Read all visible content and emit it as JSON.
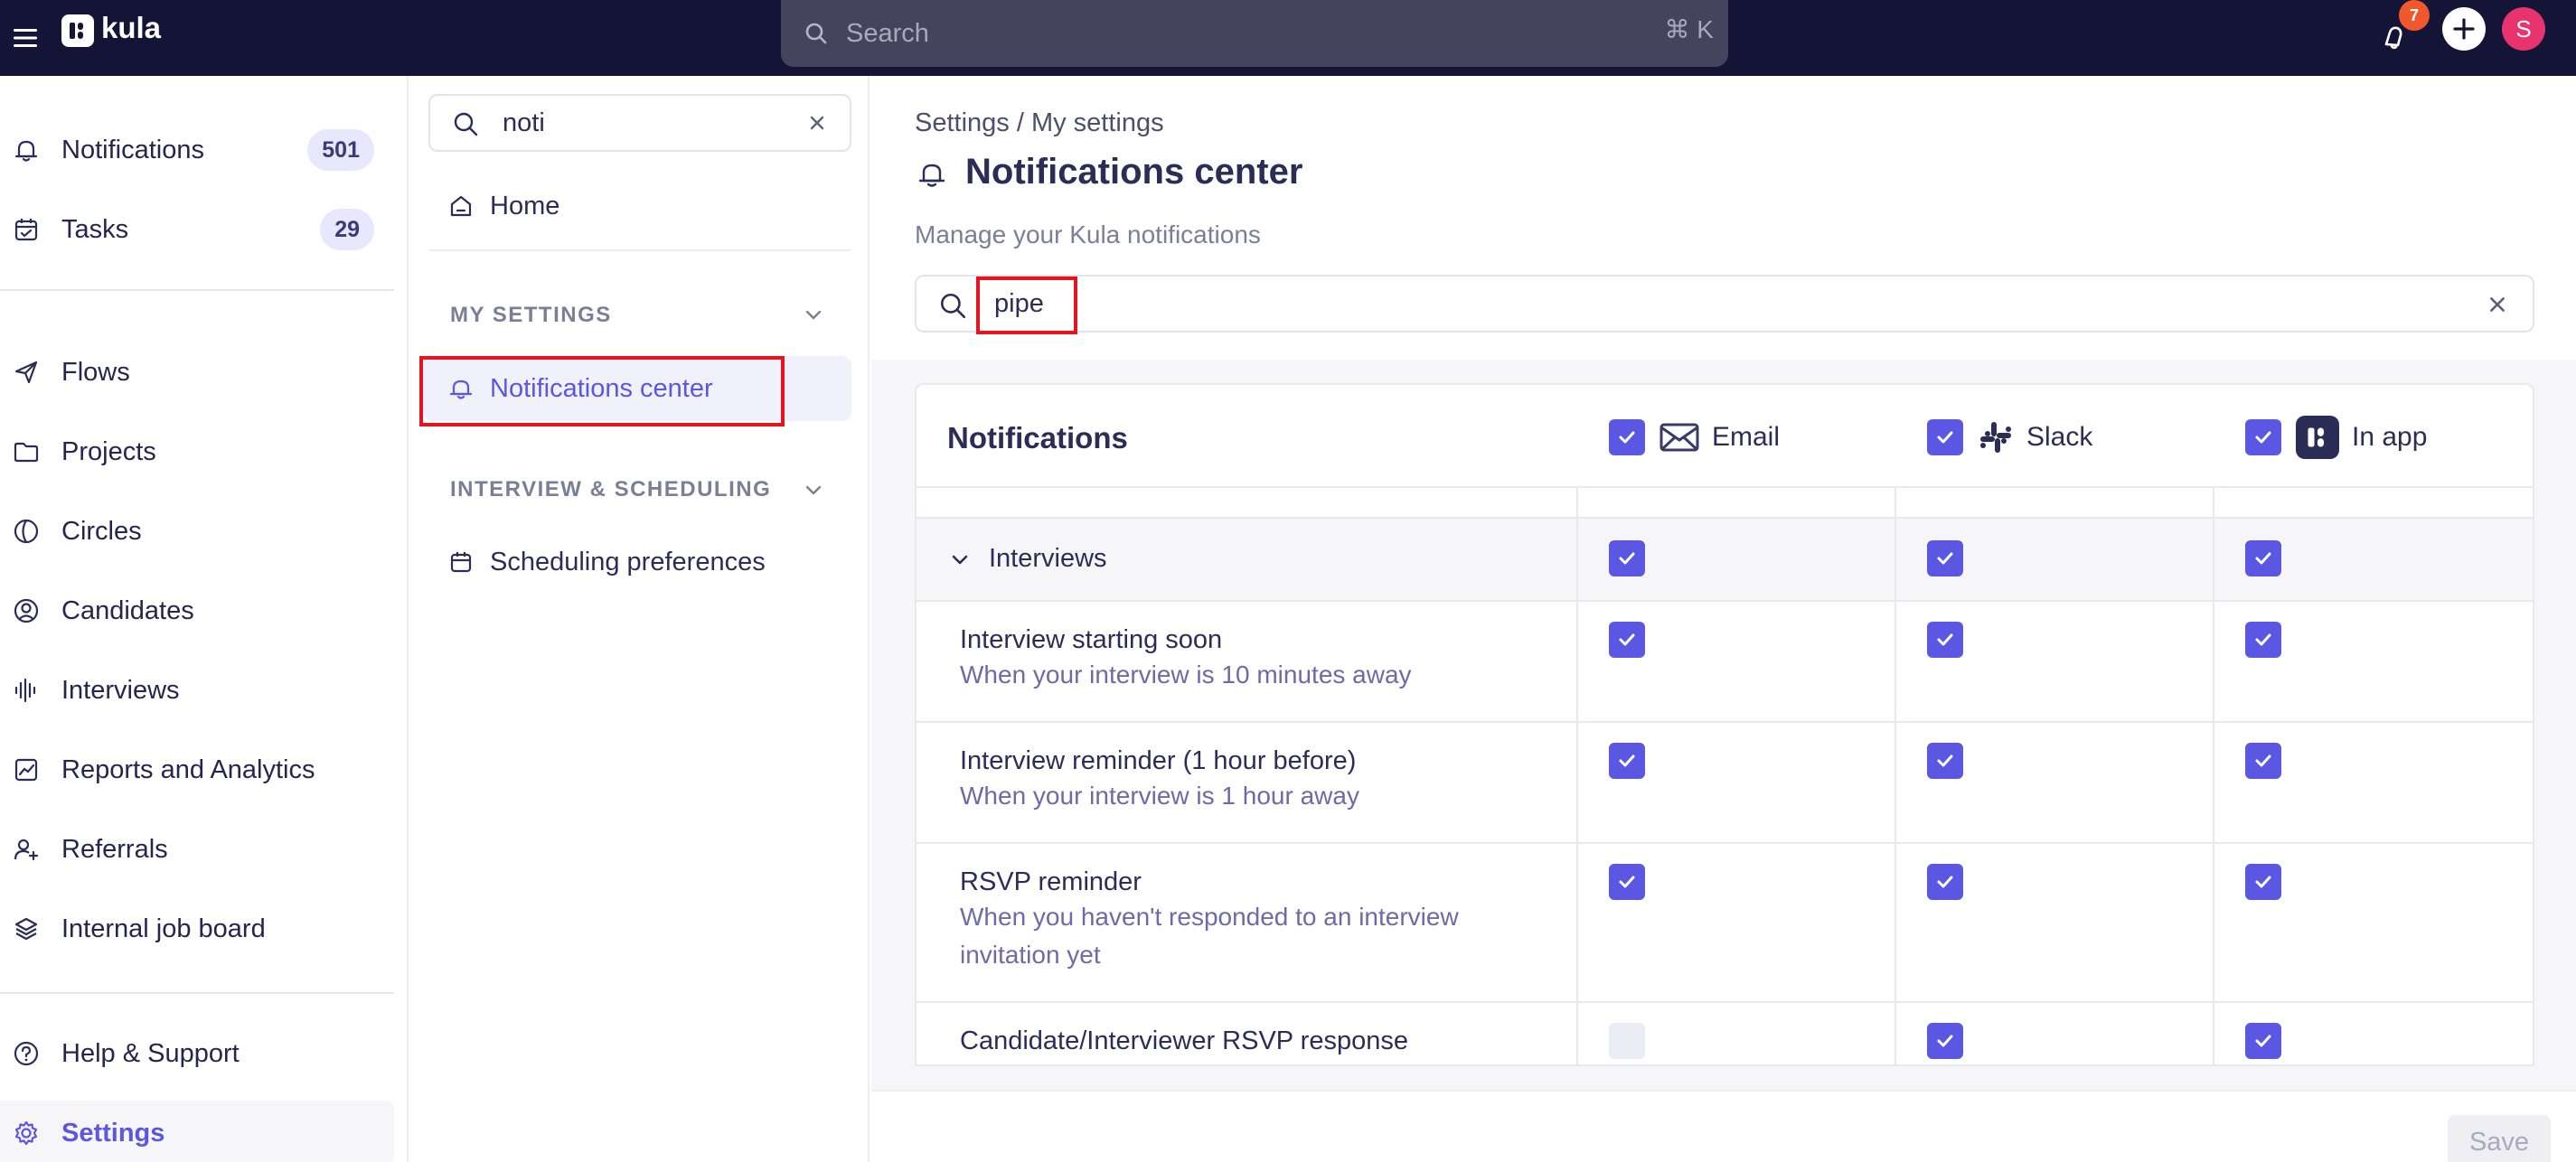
{
  "app": {
    "brand": "kula"
  },
  "topbar": {
    "search_placeholder": "Search",
    "shortcut": "⌘ K",
    "notifications_count": "7",
    "avatar_initial": "S"
  },
  "nav": {
    "items": [
      {
        "label": "Notifications",
        "badge": "501",
        "icon": "bell-icon"
      },
      {
        "label": "Tasks",
        "badge": "29",
        "icon": "calendar-check-icon"
      },
      {
        "label": "Flows",
        "icon": "send-icon"
      },
      {
        "label": "Projects",
        "icon": "folder-icon"
      },
      {
        "label": "Circles",
        "icon": "circles-icon"
      },
      {
        "label": "Candidates",
        "icon": "user-circle-icon"
      },
      {
        "label": "Interviews",
        "icon": "waveform-icon"
      },
      {
        "label": "Reports and Analytics",
        "icon": "chart-icon"
      },
      {
        "label": "Referrals",
        "icon": "user-plus-icon"
      },
      {
        "label": "Internal job board",
        "icon": "stack-icon"
      },
      {
        "label": "Help & Support",
        "icon": "help-icon"
      },
      {
        "label": "Settings",
        "icon": "gear-icon"
      }
    ]
  },
  "settings_sidebar": {
    "search_value": "noti",
    "home_label": "Home",
    "section_my_settings": "MY SETTINGS",
    "notifications_center": "Notifications center",
    "section_interview": "INTERVIEW & SCHEDULING",
    "scheduling_preferences": "Scheduling preferences"
  },
  "main": {
    "breadcrumb": "Settings / My settings",
    "title": "Notifications center",
    "subtitle": "Manage your Kula notifications",
    "search_value": "pipe",
    "save_label": "Save"
  },
  "table": {
    "header": "Notifications",
    "channels": [
      {
        "name": "Email",
        "checked": true
      },
      {
        "name": "Slack",
        "checked": true
      },
      {
        "name": "In app",
        "checked": true
      }
    ],
    "group": {
      "label": "Interviews",
      "checked": [
        true,
        true,
        true
      ]
    },
    "rows": [
      {
        "title": "Interview starting soon",
        "description": "When your interview is 10 minutes away",
        "checked": [
          true,
          true,
          true
        ]
      },
      {
        "title": "Interview reminder (1 hour before)",
        "description": "When your interview is 1 hour away",
        "checked": [
          true,
          true,
          true
        ]
      },
      {
        "title": "RSVP reminder",
        "description": "When you haven't responded to an interview invitation yet",
        "checked": [
          true,
          true,
          true
        ]
      },
      {
        "title": "Candidate/Interviewer RSVP response",
        "description": "",
        "checked": [
          false,
          true,
          true
        ]
      }
    ]
  },
  "colors": {
    "topbar": "#141437",
    "accent": "#5b57e3",
    "highlight": "#e6141e",
    "badge_orange": "#f0572d",
    "avatar_pink": "#e8336f"
  }
}
